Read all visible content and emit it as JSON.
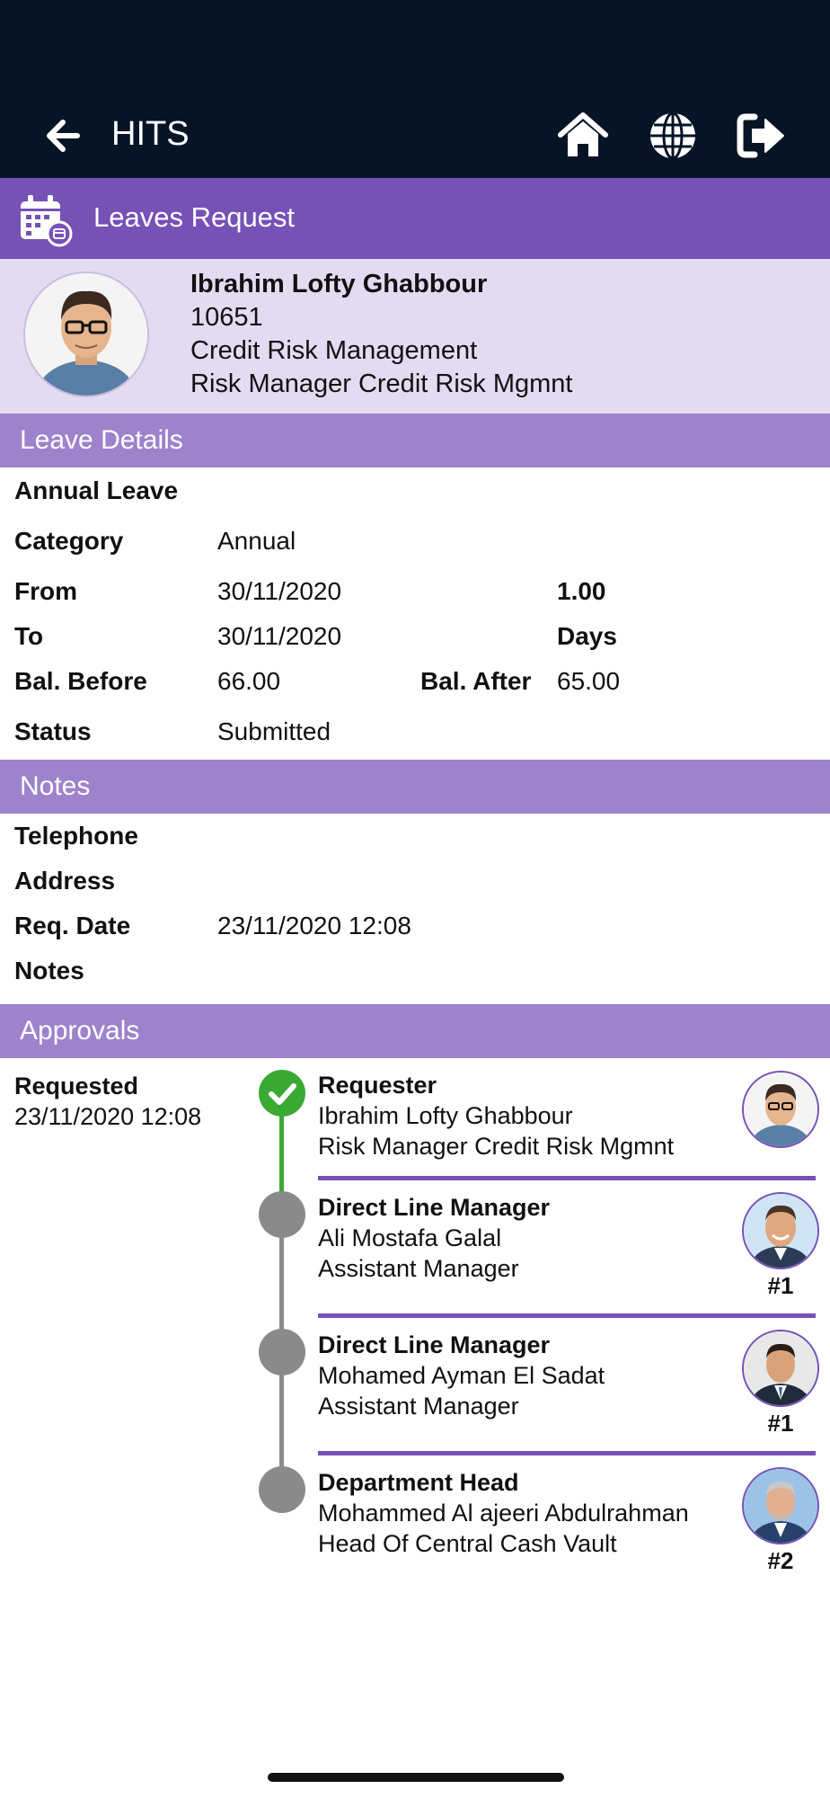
{
  "header": {
    "app_title": "HITS",
    "icons": [
      "arrow-left-icon",
      "home-icon",
      "globe-icon",
      "sign-out-icon"
    ]
  },
  "page": {
    "title": "Leaves Request",
    "icon": "calendar-icon"
  },
  "employee": {
    "name": "Ibrahim Lofty Ghabbour",
    "id": "10651",
    "department": "Credit Risk Management",
    "position": "Risk Manager Credit Risk Mgmnt"
  },
  "leave_details": {
    "heading": "Leave Details",
    "leave_type": "Annual Leave",
    "category_label": "Category",
    "category_value": "Annual",
    "from_label": "From",
    "from_value": "30/11/2020",
    "to_label": "To",
    "to_value": "30/11/2020",
    "days_value": "1.00",
    "days_label": "Days",
    "bal_before_label": "Bal. Before",
    "bal_before_value": "66.00",
    "bal_after_label": "Bal. After",
    "bal_after_value": "65.00",
    "status_label": "Status",
    "status_value": "Submitted"
  },
  "notes": {
    "heading": "Notes",
    "telephone_label": "Telephone",
    "address_label": "Address",
    "req_date_label": "Req. Date",
    "req_date_value": "23/11/2020 12:08",
    "notes_label": "Notes"
  },
  "approvals": {
    "heading": "Approvals",
    "requested_label": "Requested",
    "requested_date": "23/11/2020 12:08",
    "steps": [
      {
        "role": "Requester",
        "name": "Ibrahim Lofty Ghabbour",
        "title": "Risk Manager Credit Risk Mgmnt",
        "level": "",
        "status": "done"
      },
      {
        "role": "Direct Line Manager",
        "name": "Ali Mostafa Galal",
        "title": "Assistant Manager",
        "level": "#1",
        "status": "pending"
      },
      {
        "role": "Direct Line Manager",
        "name": "Mohamed Ayman El Sadat",
        "title": "Assistant Manager",
        "level": "#1",
        "status": "pending"
      },
      {
        "role": "Department Head",
        "name": "Mohammed Al ajeeri Abdulrahman",
        "title": "Head Of Central Cash Vault",
        "level": "#2",
        "status": "pending"
      }
    ]
  },
  "colors": {
    "topbar": "#061426",
    "primary": "#7651b6",
    "strip": "#9e82cb",
    "profile_bg": "#e3dbf1",
    "done": "#3aaa35",
    "pending": "#8a8a8a"
  }
}
